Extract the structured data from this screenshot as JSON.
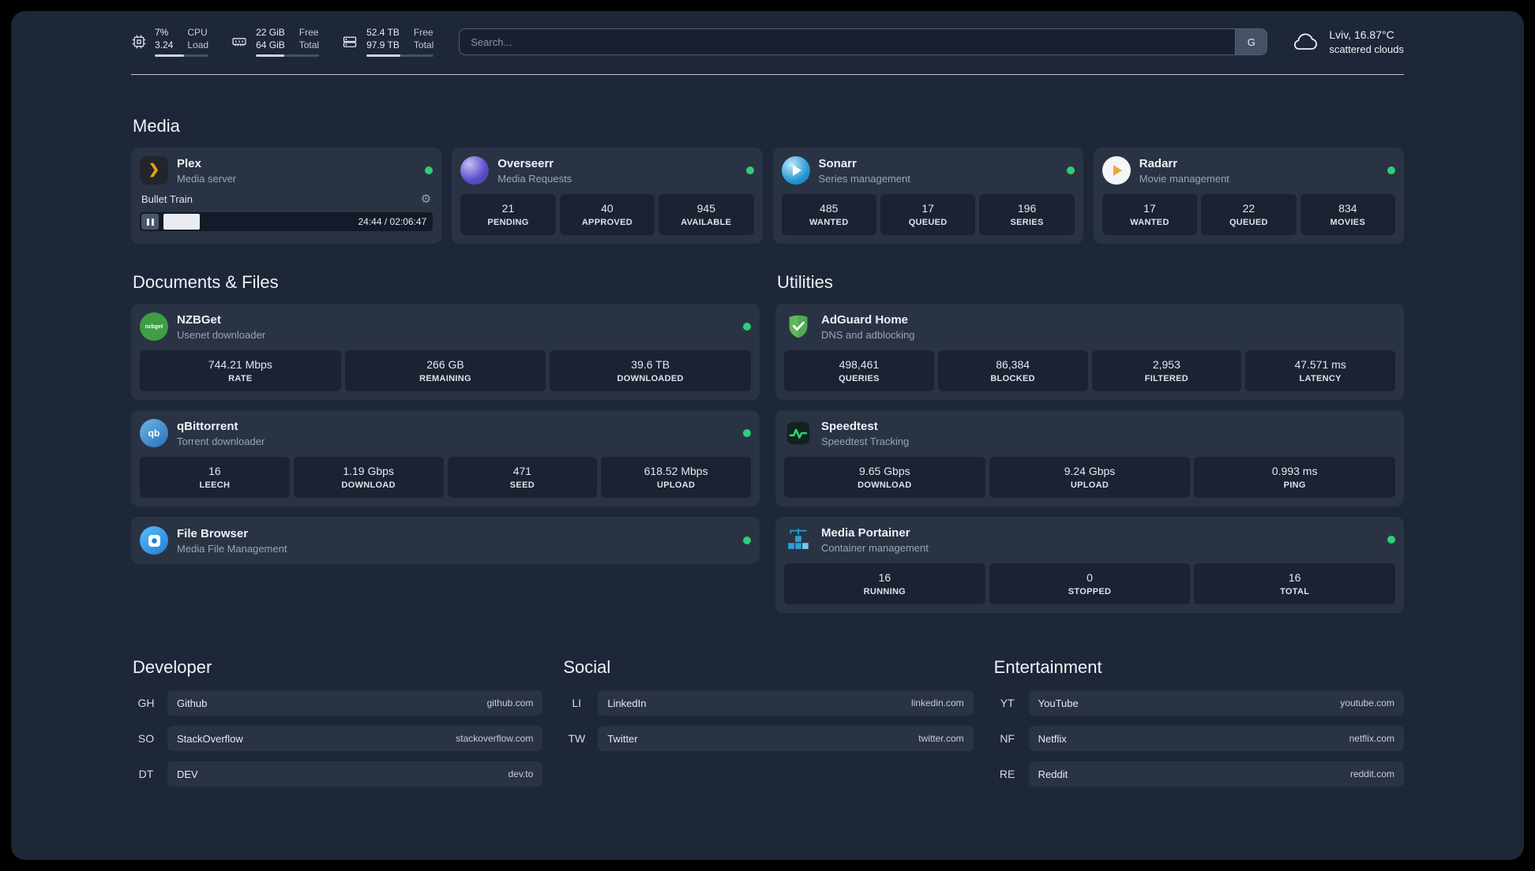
{
  "topbar": {
    "cpu": {
      "value_top": "7%",
      "value_bottom": "3.24",
      "label_top": "CPU",
      "label_bottom": "Load",
      "progress_percent": 55
    },
    "memory": {
      "value_top": "22 GiB",
      "value_bottom": "64 GiB",
      "label_top": "Free",
      "label_bottom": "Total",
      "progress_percent": 45
    },
    "disk": {
      "value_top": "52.4 TB",
      "value_bottom": "97.9 TB",
      "label_top": "Free",
      "label_bottom": "Total",
      "progress_percent": 50
    },
    "search": {
      "placeholder": "Search...",
      "provider_label": "G"
    },
    "weather": {
      "location": "Lviv, 16.87°C",
      "condition": "scattered clouds"
    }
  },
  "sections": {
    "media": "Media",
    "documents": "Documents & Files",
    "utilities": "Utilities",
    "developer": "Developer",
    "social": "Social",
    "entertainment": "Entertainment"
  },
  "media": {
    "plex": {
      "name": "Plex",
      "description": "Media server",
      "status": "online",
      "now_playing": "Bullet Train",
      "progress_percent": 19,
      "time": "24:44 / 02:06:47"
    },
    "overseerr": {
      "name": "Overseerr",
      "description": "Media Requests",
      "status": "online",
      "stats": [
        {
          "value": "21",
          "label": "PENDING"
        },
        {
          "value": "40",
          "label": "APPROVED"
        },
        {
          "value": "945",
          "label": "AVAILABLE"
        }
      ]
    },
    "sonarr": {
      "name": "Sonarr",
      "description": "Series management",
      "status": "online",
      "stats": [
        {
          "value": "485",
          "label": "WANTED"
        },
        {
          "value": "17",
          "label": "QUEUED"
        },
        {
          "value": "196",
          "label": "SERIES"
        }
      ]
    },
    "radarr": {
      "name": "Radarr",
      "description": "Movie management",
      "status": "online",
      "stats": [
        {
          "value": "17",
          "label": "WANTED"
        },
        {
          "value": "22",
          "label": "QUEUED"
        },
        {
          "value": "834",
          "label": "MOVIES"
        }
      ]
    }
  },
  "documents": {
    "nzbget": {
      "name": "NZBGet",
      "description": "Usenet downloader",
      "status": "online",
      "stats": [
        {
          "value": "744.21 Mbps",
          "label": "RATE"
        },
        {
          "value": "266 GB",
          "label": "REMAINING"
        },
        {
          "value": "39.6 TB",
          "label": "DOWNLOADED"
        }
      ]
    },
    "qbittorrent": {
      "name": "qBittorrent",
      "description": "Torrent downloader",
      "status": "online",
      "stats": [
        {
          "value": "16",
          "label": "LEECH"
        },
        {
          "value": "1.19 Gbps",
          "label": "DOWNLOAD"
        },
        {
          "value": "471",
          "label": "SEED"
        },
        {
          "value": "618.52 Mbps",
          "label": "UPLOAD"
        }
      ]
    },
    "filebrowser": {
      "name": "File Browser",
      "description": "Media File Management",
      "status": "online"
    }
  },
  "utilities": {
    "adguard": {
      "name": "AdGuard Home",
      "description": "DNS and adblocking",
      "stats": [
        {
          "value": "498,461",
          "label": "QUERIES"
        },
        {
          "value": "86,384",
          "label": "BLOCKED"
        },
        {
          "value": "2,953",
          "label": "FILTERED"
        },
        {
          "value": "47.571 ms",
          "label": "LATENCY"
        }
      ]
    },
    "speedtest": {
      "name": "Speedtest",
      "description": "Speedtest Tracking",
      "stats": [
        {
          "value": "9.65 Gbps",
          "label": "DOWNLOAD"
        },
        {
          "value": "9.24 Gbps",
          "label": "UPLOAD"
        },
        {
          "value": "0.993 ms",
          "label": "PING"
        }
      ]
    },
    "portainer": {
      "name": "Media Portainer",
      "description": "Container management",
      "status": "online",
      "stats": [
        {
          "value": "16",
          "label": "RUNNING"
        },
        {
          "value": "0",
          "label": "STOPPED"
        },
        {
          "value": "16",
          "label": "TOTAL"
        }
      ]
    }
  },
  "bookmarks": {
    "developer": [
      {
        "abbr": "GH",
        "name": "Github",
        "domain": "github.com"
      },
      {
        "abbr": "SO",
        "name": "StackOverflow",
        "domain": "stackoverflow.com"
      },
      {
        "abbr": "DT",
        "name": "DEV",
        "domain": "dev.to"
      }
    ],
    "social": [
      {
        "abbr": "LI",
        "name": "LinkedIn",
        "domain": "linkedin.com"
      },
      {
        "abbr": "TW",
        "name": "Twitter",
        "domain": "twitter.com"
      }
    ],
    "entertainment": [
      {
        "abbr": "YT",
        "name": "YouTube",
        "domain": "youtube.com"
      },
      {
        "abbr": "NF",
        "name": "Netflix",
        "domain": "netflix.com"
      },
      {
        "abbr": "RE",
        "name": "Reddit",
        "domain": "reddit.com"
      }
    ]
  },
  "icons": {
    "plex_glyph": "❯",
    "gear_glyph": "⚙",
    "nzbget_text": "nzbget",
    "qbittorrent_text": "qb"
  },
  "colors": {
    "background": "#1e2737",
    "card": "#2a3343",
    "tile": "#1b2332",
    "status_online": "#2fce77",
    "plex_accent": "#e5a00d",
    "adguard_green": "#5db85c",
    "speedtest_green": "#2fd181",
    "portainer_blue": "#2ba0d6"
  }
}
